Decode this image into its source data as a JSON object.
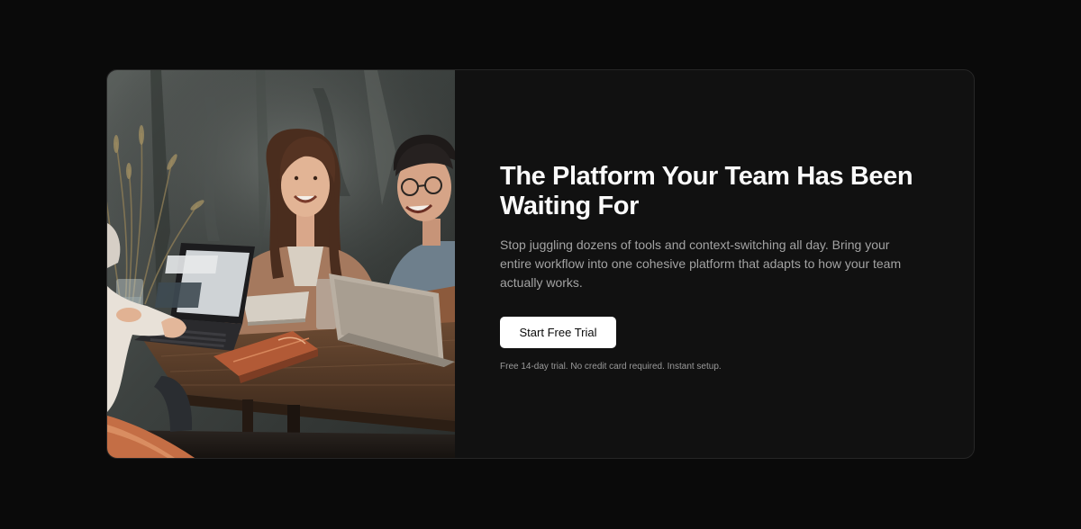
{
  "hero": {
    "headline": "The Platform Your Team Has Been Waiting For",
    "description": "Stop juggling dozens of tools and context-switching all day. Bring your entire workflow into one cohesive platform that adapts to how your team actually works.",
    "cta_label": "Start Free Trial",
    "note": "Free 14-day trial. No credit card required. Instant setup."
  },
  "colors": {
    "page_background": "#0a0a0a",
    "card_background": "#111111",
    "headline": "#fafafa",
    "body_text": "#a3a3a3",
    "button_background": "#ffffff",
    "button_text": "#0a0a0a"
  }
}
